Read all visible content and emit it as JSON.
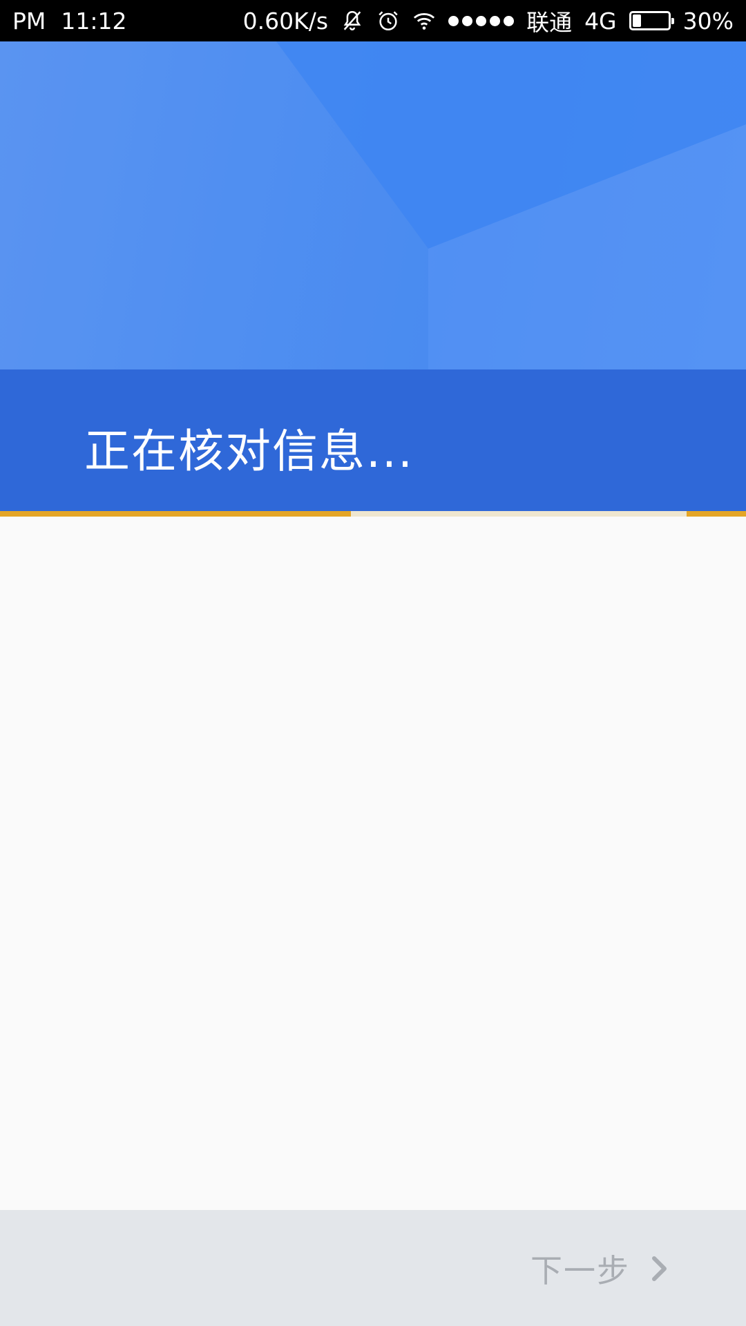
{
  "status_bar": {
    "period": "PM",
    "time": "11:12",
    "net_speed": "0.60K/s",
    "carrier": "联通",
    "network": "4G",
    "battery_level": 0.3,
    "battery_text": "30%",
    "icons": [
      "bell-off-icon",
      "alarm-icon",
      "wifi-icon",
      "signal-icon",
      "battery-icon"
    ]
  },
  "header": {
    "title": "正在核对信息...",
    "colors": {
      "band": "#2f68d8",
      "background": "#4487f1",
      "progress": "#e4a526"
    }
  },
  "progress": {
    "value": 0.47
  },
  "footer": {
    "next_label": "下一步",
    "next_icon": "chevron-right-icon"
  }
}
